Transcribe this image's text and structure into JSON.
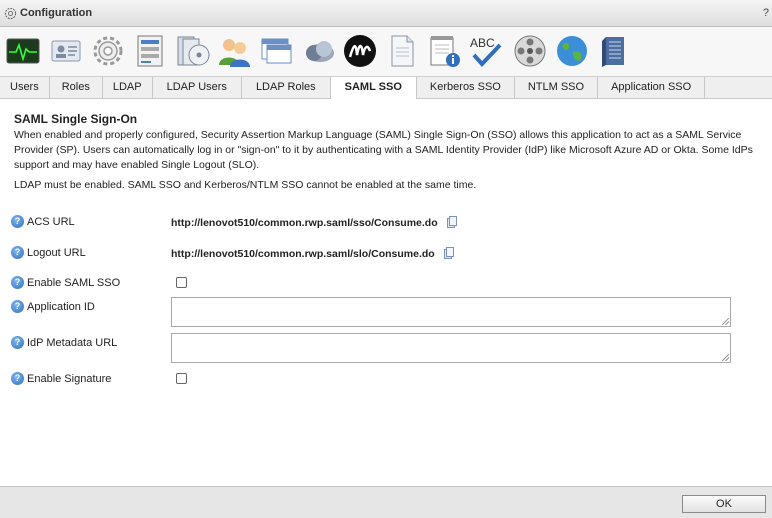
{
  "window": {
    "title": "Configuration",
    "help": "?"
  },
  "toolbar": {
    "icons": [
      "activity-monitor-icon",
      "id-card-icon",
      "gear-icon",
      "server-list-icon",
      "disk-stack-icon",
      "users-icon",
      "windows-icon",
      "cloud-icon",
      "brand-logo-icon",
      "document-icon",
      "notepad-info-icon",
      "spellcheck-abc-icon",
      "film-reel-icon",
      "globe-icon",
      "server-rack-icon"
    ]
  },
  "tabs": [
    {
      "label": "Users"
    },
    {
      "label": "Roles"
    },
    {
      "label": "LDAP"
    },
    {
      "label": "LDAP Users"
    },
    {
      "label": "LDAP Roles"
    },
    {
      "label": "SAML SSO",
      "active": true
    },
    {
      "label": "Kerberos SSO"
    },
    {
      "label": "NTLM SSO"
    },
    {
      "label": "Application SSO"
    }
  ],
  "content": {
    "title": "SAML Single Sign-On",
    "description": "When enabled and properly configured, Security Assertion Markup Language (SAML) Single Sign-On (SSO) allows this application to act as a SAML Service Provider (SP). Users can automatically log in or \"sign-on\" to it by authenticating with a SAML Identity Provider (IdP) like Microsoft Azure AD or Okta. Some IdPs support and may have enabled Single Logout (SLO).",
    "note": "LDAP must be enabled. SAML SSO and Kerberos/NTLM SSO cannot be enabled at the same time.",
    "fields": {
      "acs_label": "ACS URL",
      "acs_value": "http://lenovot510/common.rwp.saml/sso/Consume.do",
      "logout_label": "Logout URL",
      "logout_value": "http://lenovot510/common.rwp.saml/slo/Consume.do",
      "enable_saml_label": "Enable SAML SSO",
      "enable_saml_checked": false,
      "app_id_label": "Application ID",
      "app_id_value": "",
      "idp_label": "IdP Metadata URL",
      "idp_value": "",
      "enable_sig_label": "Enable Signature",
      "enable_sig_checked": false
    }
  },
  "footer": {
    "ok_label": "OK"
  },
  "colors": {
    "help_icon": "#2f6fc0",
    "active_tab_bg": "#ffffff",
    "footer_bg": "#e6e6e6"
  }
}
